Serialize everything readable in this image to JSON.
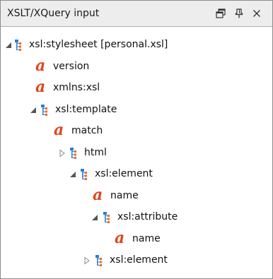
{
  "window": {
    "title": "XSLT/XQuery input",
    "buttons": [
      {
        "name": "restore-icon",
        "glyph": "restore"
      },
      {
        "name": "pin-icon",
        "glyph": "pin"
      },
      {
        "name": "close-icon",
        "glyph": "close"
      }
    ]
  },
  "tree": {
    "nodes": [
      {
        "label": "xsl:stylesheet [personal.xsl]",
        "kind": "element",
        "expanded": true
      },
      {
        "label": "version",
        "kind": "attribute"
      },
      {
        "label": "xmlns:xsl",
        "kind": "attribute"
      },
      {
        "label": "xsl:template",
        "kind": "element",
        "expanded": true
      },
      {
        "label": "match",
        "kind": "attribute"
      },
      {
        "label": "html",
        "kind": "element",
        "expanded": false
      },
      {
        "label": "xsl:element",
        "kind": "element",
        "expanded": true
      },
      {
        "label": "name",
        "kind": "attribute"
      },
      {
        "label": "xsl:attribute",
        "kind": "element",
        "expanded": true
      },
      {
        "label": "name",
        "kind": "attribute"
      },
      {
        "label": "xsl:element",
        "kind": "element",
        "expanded": false
      }
    ]
  },
  "colors": {
    "element_icon_blue": "#2d7fd3",
    "element_icon_orange": "#e86d1f",
    "attribute_icon": "#e0451c",
    "arrow": "#555555"
  }
}
